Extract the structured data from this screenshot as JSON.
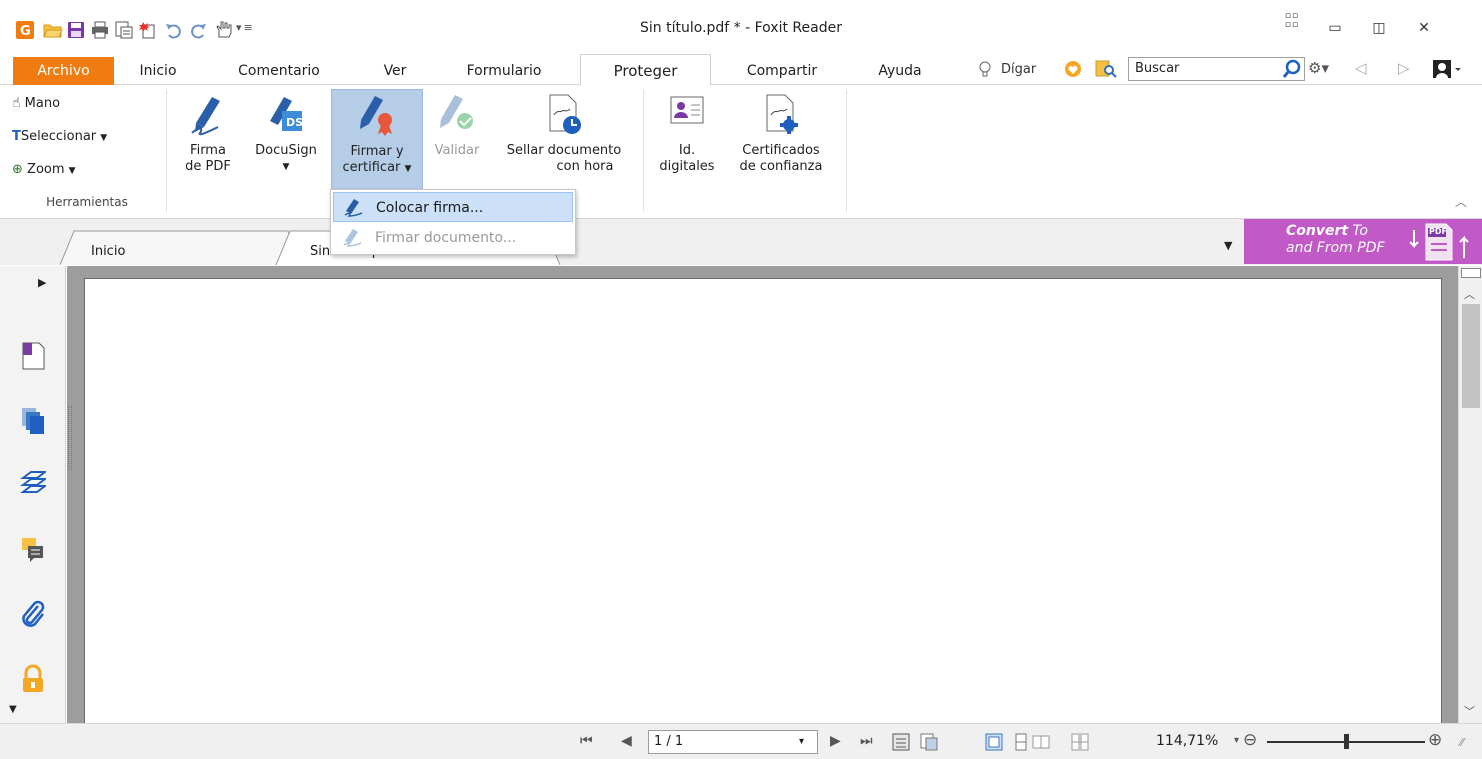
{
  "window": {
    "title": "Sin título.pdf * - Foxit Reader"
  },
  "quick_access": [
    "foxit-logo-icon",
    "open-folder-icon",
    "save-icon",
    "print-icon",
    "print-preview-icon",
    "new-doc-icon",
    "undo-icon",
    "redo-icon",
    "hand-tool-icon",
    "customize-icon"
  ],
  "ribbon_tabs": [
    {
      "label": "Archivo"
    },
    {
      "label": "Inicio"
    },
    {
      "label": "Comentario"
    },
    {
      "label": "Ver"
    },
    {
      "label": "Formulario"
    },
    {
      "label": "Proteger"
    },
    {
      "label": "Compartir"
    },
    {
      "label": "Ayuda"
    }
  ],
  "active_tab": "Proteger",
  "tell_me": "Dígar",
  "search": {
    "placeholder": "Buscar"
  },
  "tools_group": {
    "items": [
      {
        "label": "Mano"
      },
      {
        "label": "Seleccionar"
      },
      {
        "label": "Zoom"
      }
    ],
    "group_label": "Herramientas"
  },
  "protect_buttons": {
    "firma_pdf": {
      "line1": "Firma",
      "line2": "de PDF"
    },
    "docusign": {
      "line1": "DocuSign"
    },
    "firmar_certificar": {
      "line1": "Firmar y",
      "line2": "certificar"
    },
    "validar": {
      "line1": "Validar"
    },
    "sellar": {
      "line1": "Sellar documento",
      "line2": "con hora"
    },
    "id_digitales": {
      "line1": "Id.",
      "line2": "digitales"
    },
    "certificados": {
      "line1": "Certificados",
      "line2": "de confianza"
    }
  },
  "dropdown_menu": [
    {
      "label": "Colocar firma...",
      "enabled": true
    },
    {
      "label": "Firmar documento...",
      "enabled": false
    }
  ],
  "doc_tabs": [
    {
      "label": "Inicio"
    },
    {
      "label": "Sin título.pdf"
    }
  ],
  "convert_banner": {
    "line1_bold": "Convert",
    "line1_rest": " To",
    "line2": "and From PDF",
    "badge": "PDF"
  },
  "status_bar": {
    "page_indicator": "1 / 1",
    "zoom": "114,71%",
    "zoom_slider_level": 0.5
  },
  "colors": {
    "archivo_tab": "#f07b11",
    "selected_button": "#b6cde8",
    "banner": "#c159c6",
    "page_background": "#9d9d9d"
  }
}
